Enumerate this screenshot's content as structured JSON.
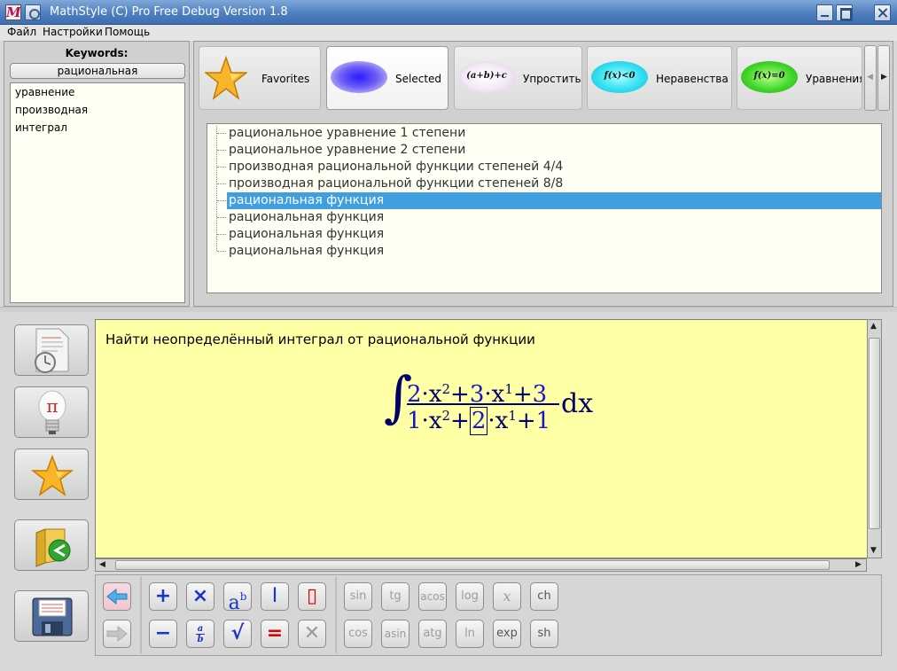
{
  "window": {
    "title": "MathStyle (C) Pro Free Debug Version 1.8",
    "app_icon_letter": "M"
  },
  "menu": [
    "Файл",
    "Настройки",
    "Помощь"
  ],
  "keywords": {
    "title": "Keywords:",
    "search_value": "рациональная",
    "items": [
      "уравнение",
      "производная",
      "интеграл"
    ]
  },
  "tabs": [
    {
      "label": "Favorites",
      "icon": "star-icon"
    },
    {
      "label": "Selected",
      "icon": "blue-oval-icon"
    },
    {
      "label": "Упростить",
      "icon_text": "(a+b)+c"
    },
    {
      "label": "Неравенства",
      "icon_text": "f(x)<0"
    },
    {
      "label": "Уравнения",
      "icon_text": "f(x)=0"
    }
  ],
  "tree": {
    "items": [
      "рациональное уравнение 1 степени",
      "рациональное уравнение 2 степени",
      "производная рациональной функции степеней 4/4",
      "производная рациональной функции степеней 8/8",
      "рациональная функция",
      "рациональная функция",
      "рациональная функция",
      "рациональная функция"
    ],
    "selected_index": 4
  },
  "side_buttons": [
    "document-clock-icon",
    "lightbulb-pi-icon",
    "star-icon",
    "folder-import-icon",
    "floppy-save-icon"
  ],
  "task": {
    "text": "Найти неопределённый интеграл от рациональной функции",
    "formula": {
      "num": {
        "a": "2",
        "b": "3",
        "c": "3",
        "var": "x",
        "p2": "2",
        "p1": "1",
        "dot": "·",
        "plus": "+"
      },
      "den": {
        "a": "1",
        "b": "2",
        "c": "1",
        "var": "x",
        "p2": "2",
        "p1": "1",
        "dot": "·",
        "plus": "+"
      },
      "integral_sign": "∫",
      "differential": "dx"
    }
  },
  "keyboard": {
    "nav": [
      "back-arrow-icon",
      "forward-arrow-icon"
    ],
    "ops": [
      "+",
      "×",
      "ab",
      "I",
      "▯",
      "−",
      "a/b",
      "√",
      "=",
      "✕"
    ],
    "funcs": [
      "sin",
      "tg",
      "acos",
      "log",
      "x",
      "ch",
      "cos",
      "asin",
      "atg",
      "ln",
      "exp",
      "sh"
    ]
  },
  "colors": {
    "accent": "#3f9fe0",
    "editor_bg": "#ffffa6",
    "formula_blue": "#1818c8",
    "formula_navy": "#000068"
  }
}
